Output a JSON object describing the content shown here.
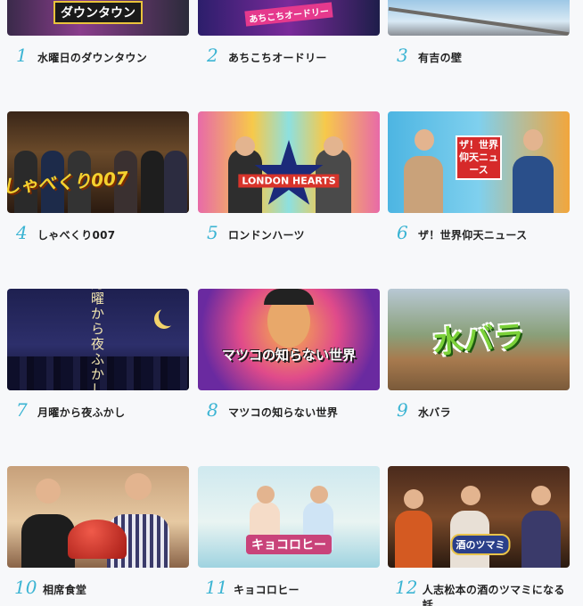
{
  "programs": [
    {
      "rank": "1",
      "title": "水曜日のダウンタウン",
      "logo": "ダウンタウン"
    },
    {
      "rank": "2",
      "title": "あちこちオードリー",
      "logo": "あちこちオードリー"
    },
    {
      "rank": "3",
      "title": "有吉の壁",
      "logo": ""
    },
    {
      "rank": "4",
      "title": "しゃべくり007",
      "logo": "しゃべくり007"
    },
    {
      "rank": "5",
      "title": "ロンドンハーツ",
      "logo": "LONDON HEARTS"
    },
    {
      "rank": "6",
      "title": "ザ！世界仰天ニュース",
      "logo": "ザ！世界仰天ニュース"
    },
    {
      "rank": "7",
      "title": "月曜から夜ふかし",
      "logo": "月曜から夜ふかし"
    },
    {
      "rank": "8",
      "title": "マツコの知らない世界",
      "logo": "マツコの知らない世界"
    },
    {
      "rank": "9",
      "title": "水バラ",
      "logo": "水バラ"
    },
    {
      "rank": "10",
      "title": "相席食堂",
      "logo": ""
    },
    {
      "rank": "11",
      "title": "キョコロヒー",
      "logo": "キョコロヒー"
    },
    {
      "rank": "12",
      "title": "人志松本の酒のツマミになる話",
      "logo": "酒のツマミ"
    }
  ],
  "colors": {
    "rank_number": "#3bb4d3",
    "title_text": "#222222",
    "background": "#f7f8fa"
  }
}
